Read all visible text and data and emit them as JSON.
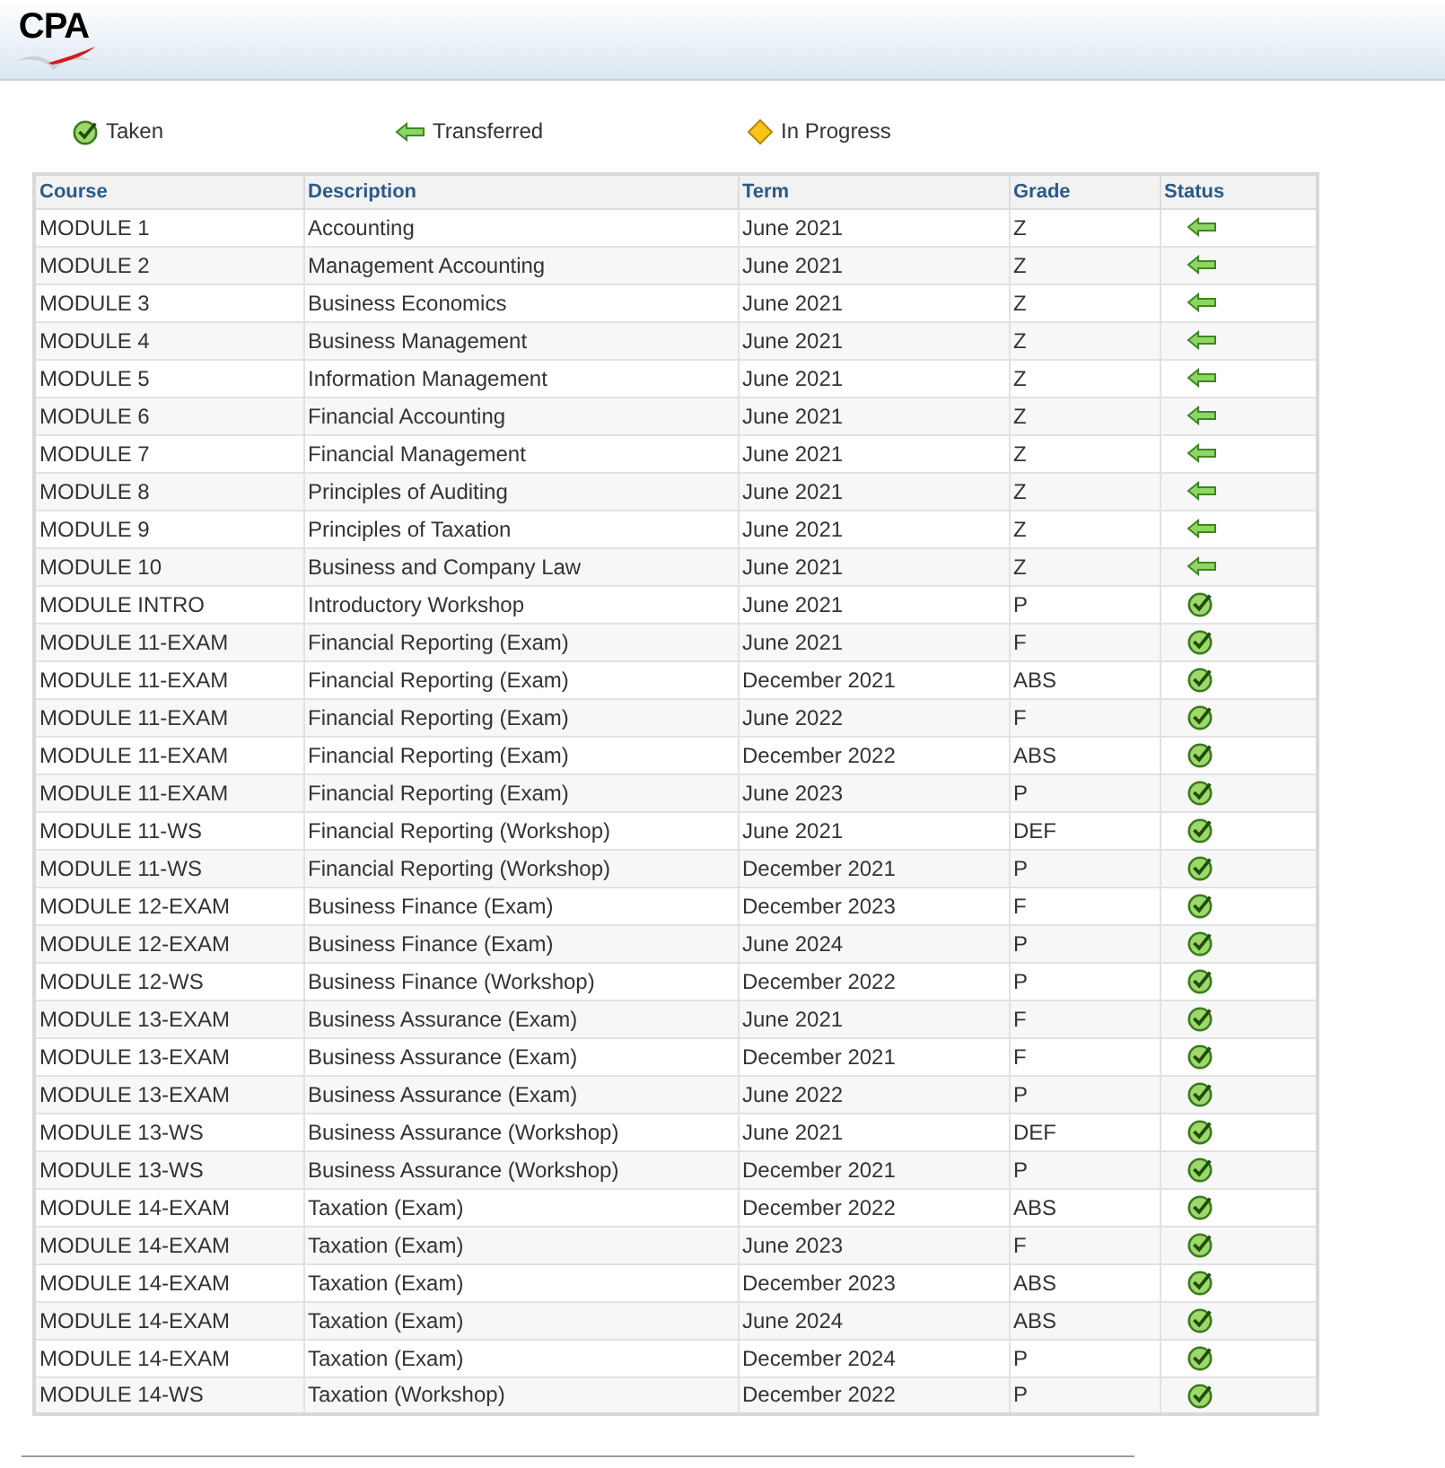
{
  "logo": {
    "text": "CPA"
  },
  "legend": [
    {
      "kind": "taken",
      "label": "Taken"
    },
    {
      "kind": "transferred",
      "label": "Transferred"
    },
    {
      "kind": "in_progress",
      "label": "In Progress"
    }
  ],
  "table": {
    "columns": [
      "Course",
      "Description",
      "Term",
      "Grade",
      "Status"
    ],
    "rows": [
      {
        "course": "MODULE 1",
        "description": "Accounting",
        "term": "June 2021",
        "grade": "Z",
        "kind": "transferred"
      },
      {
        "course": "MODULE 2",
        "description": "Management Accounting",
        "term": "June 2021",
        "grade": "Z",
        "kind": "transferred"
      },
      {
        "course": "MODULE 3",
        "description": "Business Economics",
        "term": "June 2021",
        "grade": "Z",
        "kind": "transferred"
      },
      {
        "course": "MODULE 4",
        "description": "Business Management",
        "term": "June 2021",
        "grade": "Z",
        "kind": "transferred"
      },
      {
        "course": "MODULE 5",
        "description": "Information Management",
        "term": "June 2021",
        "grade": "Z",
        "kind": "transferred"
      },
      {
        "course": "MODULE 6",
        "description": "Financial Accounting",
        "term": "June 2021",
        "grade": "Z",
        "kind": "transferred"
      },
      {
        "course": "MODULE 7",
        "description": "Financial Management",
        "term": "June 2021",
        "grade": "Z",
        "kind": "transferred"
      },
      {
        "course": "MODULE 8",
        "description": "Principles of Auditing",
        "term": "June 2021",
        "grade": "Z",
        "kind": "transferred"
      },
      {
        "course": "MODULE 9",
        "description": "Principles of Taxation",
        "term": "June 2021",
        "grade": "Z",
        "kind": "transferred"
      },
      {
        "course": "MODULE 10",
        "description": "Business and Company Law",
        "term": "June 2021",
        "grade": "Z",
        "kind": "transferred"
      },
      {
        "course": "MODULE INTRO",
        "description": "Introductory Workshop",
        "term": "June 2021",
        "grade": "P",
        "kind": "taken"
      },
      {
        "course": "MODULE 11-EXAM",
        "description": "Financial Reporting (Exam)",
        "term": "June 2021",
        "grade": "F",
        "kind": "taken"
      },
      {
        "course": "MODULE 11-EXAM",
        "description": "Financial Reporting (Exam)",
        "term": "December 2021",
        "grade": "ABS",
        "kind": "taken"
      },
      {
        "course": "MODULE 11-EXAM",
        "description": "Financial Reporting (Exam)",
        "term": "June 2022",
        "grade": "F",
        "kind": "taken"
      },
      {
        "course": "MODULE 11-EXAM",
        "description": "Financial Reporting (Exam)",
        "term": "December 2022",
        "grade": "ABS",
        "kind": "taken"
      },
      {
        "course": "MODULE 11-EXAM",
        "description": "Financial Reporting (Exam)",
        "term": "June 2023",
        "grade": "P",
        "kind": "taken"
      },
      {
        "course": "MODULE 11-WS",
        "description": "Financial Reporting (Workshop)",
        "term": "June 2021",
        "grade": "DEF",
        "kind": "taken"
      },
      {
        "course": "MODULE 11-WS",
        "description": "Financial Reporting (Workshop)",
        "term": "December 2021",
        "grade": "P",
        "kind": "taken"
      },
      {
        "course": "MODULE 12-EXAM",
        "description": "Business Finance (Exam)",
        "term": "December 2023",
        "grade": "F",
        "kind": "taken"
      },
      {
        "course": "MODULE 12-EXAM",
        "description": "Business Finance (Exam)",
        "term": "June 2024",
        "grade": "P",
        "kind": "taken"
      },
      {
        "course": "MODULE 12-WS",
        "description": "Business Finance (Workshop)",
        "term": "December 2022",
        "grade": "P",
        "kind": "taken"
      },
      {
        "course": "MODULE 13-EXAM",
        "description": "Business Assurance (Exam)",
        "term": "June 2021",
        "grade": "F",
        "kind": "taken"
      },
      {
        "course": "MODULE 13-EXAM",
        "description": "Business Assurance (Exam)",
        "term": "December 2021",
        "grade": "F",
        "kind": "taken"
      },
      {
        "course": "MODULE 13-EXAM",
        "description": "Business Assurance (Exam)",
        "term": "June 2022",
        "grade": "P",
        "kind": "taken"
      },
      {
        "course": "MODULE 13-WS",
        "description": "Business Assurance (Workshop)",
        "term": "June 2021",
        "grade": "DEF",
        "kind": "taken"
      },
      {
        "course": "MODULE 13-WS",
        "description": "Business Assurance (Workshop)",
        "term": "December 2021",
        "grade": "P",
        "kind": "taken"
      },
      {
        "course": "MODULE 14-EXAM",
        "description": "Taxation (Exam)",
        "term": "December 2022",
        "grade": "ABS",
        "kind": "taken"
      },
      {
        "course": "MODULE 14-EXAM",
        "description": "Taxation (Exam)",
        "term": "June 2023",
        "grade": "F",
        "kind": "taken"
      },
      {
        "course": "MODULE 14-EXAM",
        "description": "Taxation (Exam)",
        "term": "December 2023",
        "grade": "ABS",
        "kind": "taken"
      },
      {
        "course": "MODULE 14-EXAM",
        "description": "Taxation (Exam)",
        "term": "June 2024",
        "grade": "ABS",
        "kind": "taken"
      },
      {
        "course": "MODULE 14-EXAM",
        "description": "Taxation (Exam)",
        "term": "December 2024",
        "grade": "P",
        "kind": "taken"
      },
      {
        "course": "MODULE 14-WS",
        "description": "Taxation (Workshop)",
        "term": "December 2022",
        "grade": "P",
        "kind": "taken"
      }
    ]
  }
}
